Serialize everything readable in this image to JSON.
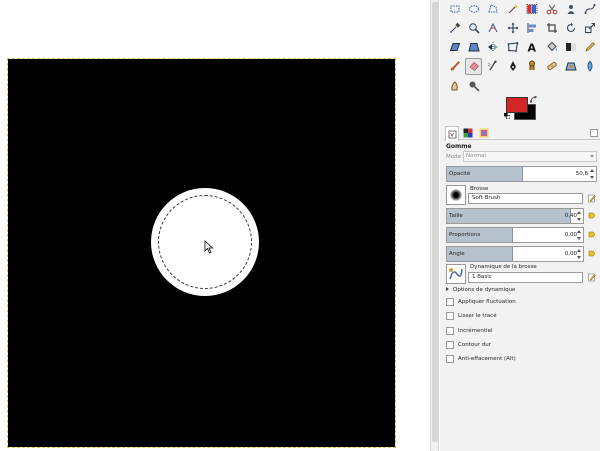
{
  "tool_options": {
    "title": "Gomme",
    "mode_label": "Mode :",
    "mode_value": "Normal",
    "opacity_label": "Opacité",
    "opacity_value": "50,8",
    "opacity_fraction": 0.508,
    "brush_heading": "Brosse",
    "brush_name": "Soft Brush",
    "size_label": "Taille",
    "size_value": "0,40",
    "proportions_label": "Proportions",
    "proportions_value": "0,00",
    "angle_label": "Angle",
    "angle_value": "0,00",
    "dynamics_heading": "Dynamique de la brosse",
    "dynamics_name": "1 Basic",
    "dynamics_options_label": "Options de dynamique",
    "checkboxes": [
      {
        "label": "Appliquer fluctuation",
        "checked": false
      },
      {
        "label": "Lisser le tracé",
        "checked": false
      },
      {
        "label": "Incrémentiel",
        "checked": false
      },
      {
        "label": "Contour dur",
        "checked": false
      },
      {
        "label": "Anti-effacement (Alt)",
        "checked": false
      }
    ]
  },
  "colors": {
    "foreground": "#d32626",
    "background": "#000000",
    "canvas_fill": "#000000",
    "accent": "#b7c2cf"
  },
  "toolbox": {
    "icons": [
      "rect-select-icon",
      "ellipse-select-icon",
      "free-select-icon",
      "fuzzy-select-icon",
      "color-select-icon",
      "scissors-icon",
      "foreground-select-icon",
      "paths-icon",
      "color-picker-icon",
      "zoom-icon",
      "measure-icon",
      "move-icon",
      "align-icon",
      "crop-icon",
      "rotate-icon",
      "scale-icon",
      "shear-icon",
      "perspective-icon",
      "flip-icon",
      "cage-icon",
      "text-icon",
      "bucket-fill-icon",
      "gradient-icon",
      "pencil-icon",
      "paintbrush-icon",
      "eraser-icon",
      "airbrush-icon",
      "ink-icon",
      "clone-icon",
      "heal-icon",
      "perspective-clone-icon",
      "blur-icon",
      "smudge-icon",
      "dodge-burn-icon"
    ],
    "active_tool": "eraser-icon"
  }
}
